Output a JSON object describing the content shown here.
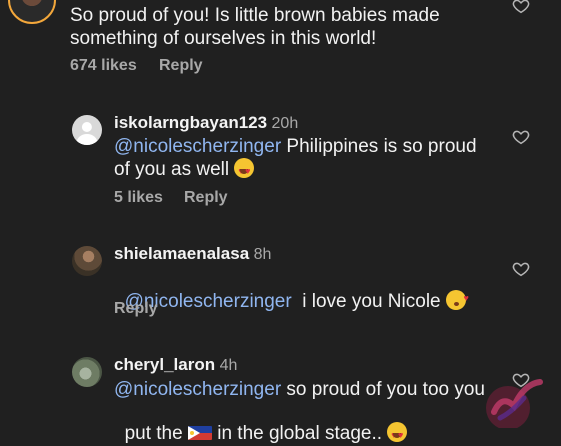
{
  "comments": [
    {
      "username": "",
      "time": "",
      "text": "So proud of you! Is little brown babies made",
      "text2": "something of ourselves in this world!",
      "likes": "674 likes",
      "reply": "Reply"
    },
    {
      "username": "iskolarngbayan123",
      "time": "20h",
      "mention": "@nicolescherzinger",
      "text": " Philippines is so proud",
      "text2": "of you as well ",
      "likes": "5 likes",
      "reply": "Reply"
    },
    {
      "username": "shielamaenalasa",
      "time": "8h",
      "mention": "@nicolescherzinger",
      "text": "  i love you Nicole ",
      "reply": "Reply"
    },
    {
      "username": "cheryl_laron",
      "time": "4h",
      "mention": "@nicolescherzinger",
      "text": " so proud of you too you",
      "text2_a": "put the ",
      "text2_b": " in the global stage.. "
    }
  ],
  "icons": {
    "like": "heart-outline-icon",
    "emoji_heart_eyes": "smiling-face-with-heart-eyes-emoji",
    "emoji_kiss": "face-blowing-a-kiss-emoji",
    "flag": "philippines-flag-emoji"
  },
  "colors": {
    "background": "#202020",
    "mention": "#90b6f0",
    "muted": "#a8a8a8",
    "story_ring": "#f3a73b"
  }
}
